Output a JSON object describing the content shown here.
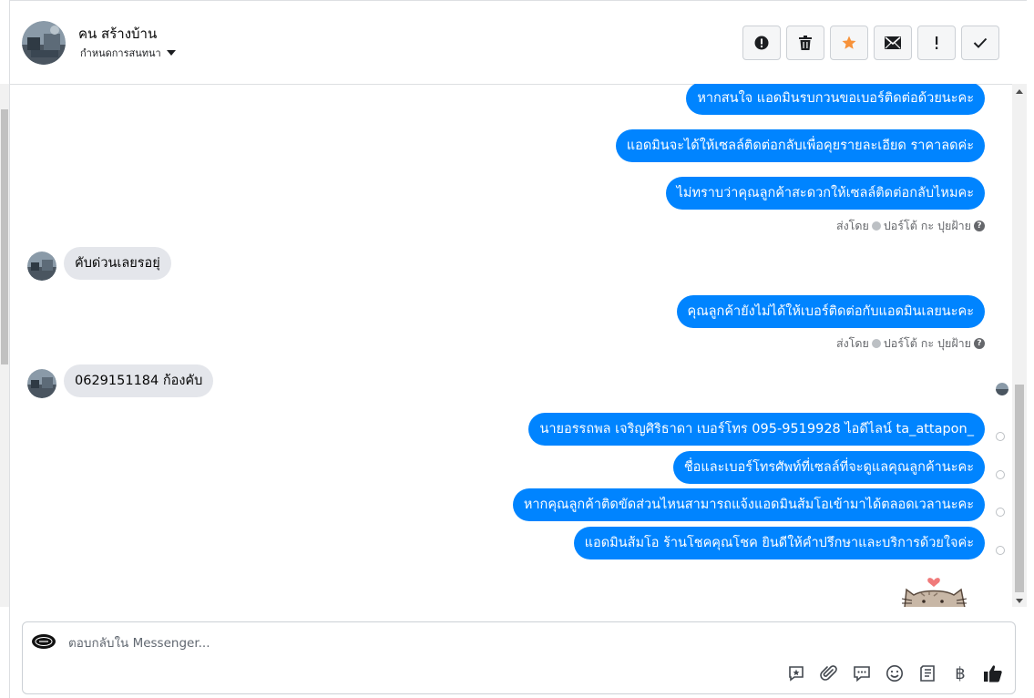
{
  "header": {
    "contact_name": "คน สร้างบ้าน",
    "subtitle": "กำหนดการสนทนา",
    "toolbar": [
      {
        "name": "alert-icon-button",
        "icon": "exclamation-circle-icon"
      },
      {
        "name": "delete-button",
        "icon": "trash-icon"
      },
      {
        "name": "star-button",
        "icon": "star-icon"
      },
      {
        "name": "mark-unread-button",
        "icon": "envelope-icon"
      },
      {
        "name": "spam-button",
        "icon": "exclamation-icon"
      },
      {
        "name": "done-button",
        "icon": "check-icon"
      }
    ]
  },
  "messages": {
    "out1": "หากสนใจ แอดมินรบกวนขอเบอร์ติดต่อด้วยนะคะ",
    "out2": "แอดมินจะได้ให้เซลล์ติดต่อกลับเพื่อคุยรายละเอียด ราคาลดค่ะ",
    "out3": "ไม่ทราบว่าคุณลูกค้าสะดวกให้เซลล์ติดต่อกลับไหมคะ",
    "sent_by_1": "ส่งโดย",
    "sender_1": "ปอร์โต้ กะ ปุยฝ้าย",
    "in1": "คับด่วนเลยรอยุ่",
    "out4": "คุณลูกค้ายังไม่ได้ให้เบอร์ติดต่อกับแอดมินเลยนะคะ",
    "sent_by_2": "ส่งโดย",
    "sender_2": "ปอร์โต้ กะ ปุยฝ้าย",
    "in2": "0629151184 ก้องคับ",
    "out5": "นายอรรถพล เจริญศิริธาดา     เบอร์โทร 095-9519928 ไอดีไลน์ ta_attapon_",
    "out6": "ชื่อและเบอร์โทรศัพท์ที่เซลล์ที่จะดูแลคุณลูกค้านะคะ",
    "out7": "หากคุณลูกค้าติดขัดส่วนไหนสามารถแจ้งแอดมินส้มโอเข้ามาได้ตลอดเวลานะคะ",
    "out8": "แอดมินส้มโอ ร้านโชคคุณโชค ยินดีให้คำปรึกษาและบริการด้วยใจค่ะ"
  },
  "composer": {
    "placeholder": "ตอบกลับใน Messenger...",
    "tools": [
      "saved-reply-icon",
      "attachment-icon",
      "chat-bubble-icon",
      "emoji-icon",
      "receipt-icon",
      "baht-icon",
      "thumbs-up-icon"
    ]
  },
  "colors": {
    "bubble_out": "#0084ff",
    "bubble_in": "#e4e6eb",
    "star": "#f7923a"
  }
}
